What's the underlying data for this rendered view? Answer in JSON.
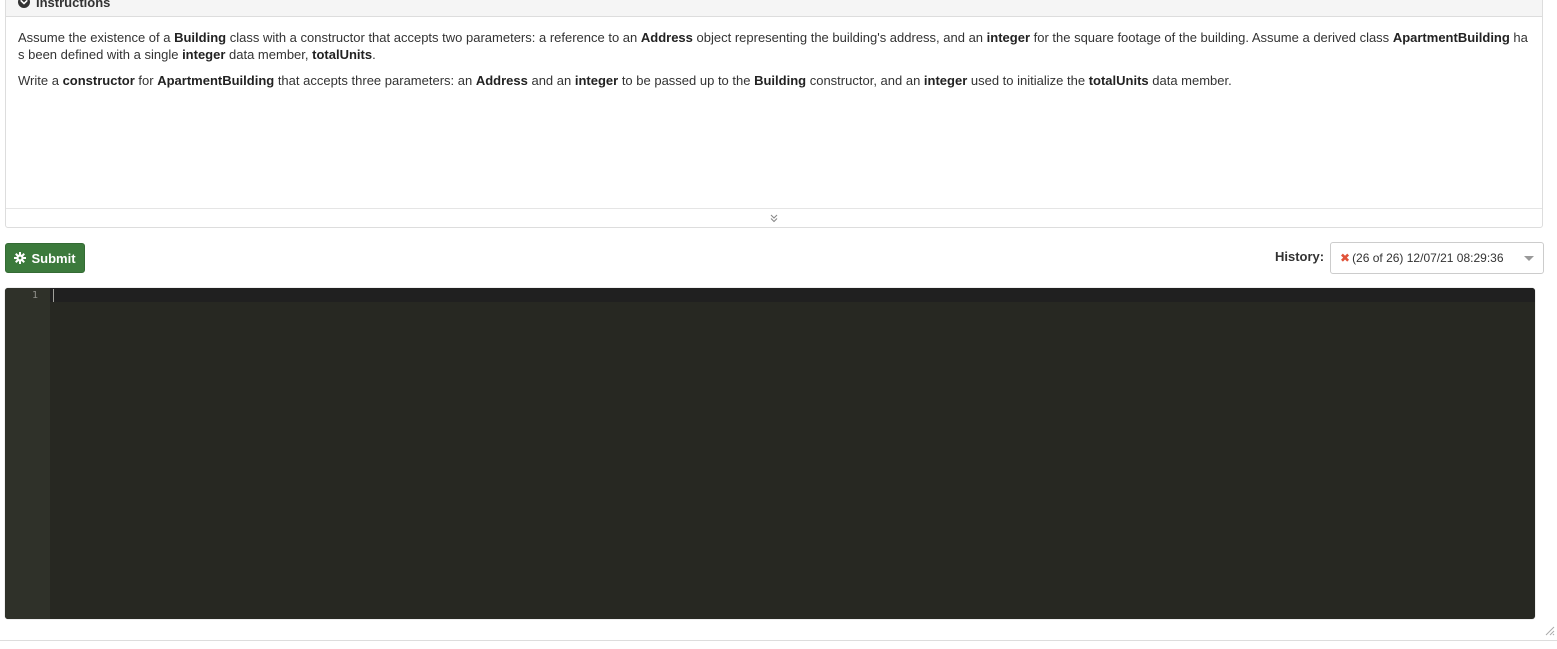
{
  "instructions": {
    "title": "Instructions",
    "p1": [
      {
        "t": "Assume",
        "b": false
      },
      {
        "t": " the existence of a ",
        "b": false
      },
      {
        "t": "Building",
        "b": true
      },
      {
        "t": " class",
        "b": false
      },
      {
        "t": " with a ",
        "b": false
      },
      {
        "t": "constructor",
        "b": false
      },
      {
        "t": " that accepts two ",
        "b": false
      },
      {
        "t": "parameters",
        "b": false
      },
      {
        "t": ": a reference to an ",
        "b": false
      },
      {
        "t": "Address",
        "b": true
      },
      {
        "t": " object",
        "b": false
      },
      {
        "t": " representing the building's address, and an ",
        "b": false
      },
      {
        "t": "integer",
        "b": true
      },
      {
        "t": " for the square footage of the building. ",
        "b": false
      },
      {
        "t": "Assume",
        "b": false
      },
      {
        "t": " a derived ",
        "b": false
      },
      {
        "t": "class",
        "b": false
      },
      {
        "t": " ",
        "b": false
      },
      {
        "t": "ApartmentBuilding",
        "b": true
      },
      {
        "t": " has been defined with a single ",
        "b": false
      },
      {
        "t": "integer",
        "b": true
      },
      {
        "t": " data member, ",
        "b": false
      },
      {
        "t": "totalUnits",
        "b": true
      },
      {
        "t": ".",
        "b": false
      }
    ],
    "p2": [
      {
        "t": "Write a ",
        "b": false
      },
      {
        "t": "constructor",
        "b": true
      },
      {
        "t": " for ",
        "b": false
      },
      {
        "t": "ApartmentBuilding",
        "b": true
      },
      {
        "t": " that accepts three ",
        "b": false
      },
      {
        "t": "parameters",
        "b": false
      },
      {
        "t": ": an ",
        "b": false
      },
      {
        "t": "Address",
        "b": true
      },
      {
        "t": " and an ",
        "b": false
      },
      {
        "t": "integer",
        "b": true
      },
      {
        "t": " to be passed up to the ",
        "b": false
      },
      {
        "t": "Building",
        "b": true
      },
      {
        "t": " ",
        "b": false
      },
      {
        "t": "constructor",
        "b": false
      },
      {
        "t": ", and an ",
        "b": false
      },
      {
        "t": "integer",
        "b": true
      },
      {
        "t": " used to ",
        "b": false
      },
      {
        "t": "initialize",
        "b": false
      },
      {
        "t": " the ",
        "b": false
      },
      {
        "t": "totalUnits",
        "b": true
      },
      {
        "t": " data member.",
        "b": false
      }
    ]
  },
  "toolbar": {
    "submit_label": "Submit",
    "submit_icon": "gear-icon",
    "history_label": "History:",
    "history_selected": "(26 of 26) 12/07/21 08:29:36",
    "history_status_icon": "x-icon",
    "history_status_color": "#e0533a"
  },
  "editor": {
    "line_numbers": [
      "1"
    ],
    "code": "",
    "background": "#272822"
  },
  "colors": {
    "submit_bg": "#3c7a3c",
    "panel_border": "#dddddd"
  }
}
